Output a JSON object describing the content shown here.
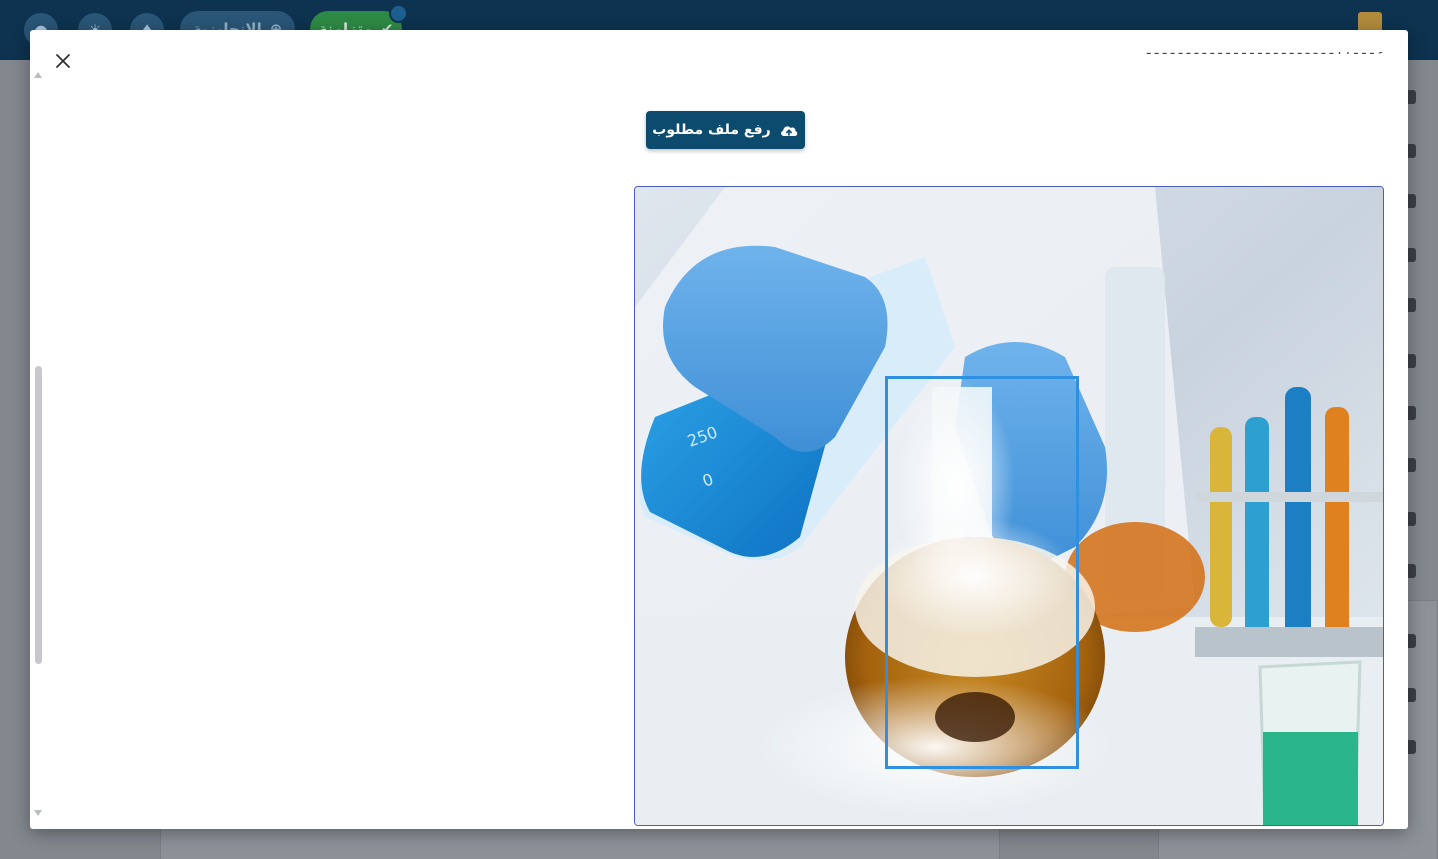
{
  "topbar": {
    "language_label": "الإنجليزية",
    "status_label": "متزامنة"
  },
  "modal": {
    "upload_button_label": "رفع ملف مطلوب",
    "upload_icon": "cloud-upload-icon",
    "close_icon": "close-icon"
  },
  "colors": {
    "topbar": "#0d3350",
    "primary_button": "#0c4a6e",
    "status_green": "#2e8a45",
    "selection_box": "#2f8fe0"
  }
}
